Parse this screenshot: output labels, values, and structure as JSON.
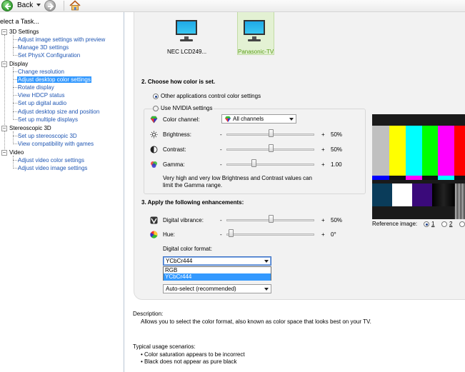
{
  "toolbar": {
    "back_label": "Back"
  },
  "sidebar": {
    "header": "elect a Task...",
    "categories": [
      {
        "label": "3D Settings",
        "items": [
          "Adjust image settings with preview",
          "Manage 3D settings",
          "Set PhysX Configuration"
        ]
      },
      {
        "label": "Display",
        "items": [
          "Change resolution",
          "Adjust desktop color settings",
          "Rotate display",
          "View HDCP status",
          "Set up digital audio",
          "Adjust desktop size and position",
          "Set up multiple displays"
        ]
      },
      {
        "label": "Stereoscopic 3D",
        "items": [
          "Set up stereoscopic 3D",
          "View compatibility with games"
        ]
      },
      {
        "label": "Video",
        "items": [
          "Adjust video color settings",
          "Adjust video image settings"
        ]
      }
    ],
    "selected_item": "Adjust desktop color settings"
  },
  "displays": [
    {
      "label": "NEC LCD249..."
    },
    {
      "label": "Panasonic-TV"
    }
  ],
  "section2": {
    "title": "2. Choose how color is set.",
    "radio_other": "Other applications control color settings",
    "radio_nvidia": "Use NVIDIA settings",
    "color_channel_label": "Color channel:",
    "color_channel_value": "All channels",
    "brightness": {
      "label": "Brightness:",
      "value": "50%",
      "level": 0.5
    },
    "contrast": {
      "label": "Contrast:",
      "value": "50%",
      "level": 0.5
    },
    "gamma": {
      "label": "Gamma:",
      "value": "1.00",
      "level": 0.3
    },
    "note": "Very high and very low Brightness and Contrast values can limit the Gamma range."
  },
  "section3": {
    "title": "3. Apply the following enhancements:",
    "vibrance": {
      "label": "Digital vibrance:",
      "value": "50%",
      "level": 0.5
    },
    "hue": {
      "label": "Hue:",
      "value": "0°",
      "level": 0.0
    },
    "format_label": "Digital color format:",
    "format_value": "YCbCr444",
    "format_options": [
      "RGB",
      "YCbCr444"
    ],
    "range_value": "Auto-select (recommended)"
  },
  "reference": {
    "label": "Reference image:",
    "options": [
      "1",
      "2"
    ],
    "selected": "1"
  },
  "description": {
    "title": "Description:",
    "text": "Allows you to select the color format, also known as color space that looks best on your TV."
  },
  "usage": {
    "title": "Typical usage scenarios:",
    "items": [
      "• Color saturation appears to be incorrect",
      "• Black does not appear as pure black"
    ]
  },
  "slider_signs": {
    "minus": "-",
    "plus": "+"
  },
  "colors": {
    "link": "#1f56b3",
    "selection": "#3399ff",
    "selected_display": "#5b9e1a",
    "pattern_bars": [
      "#c0c0c0",
      "#ffff00",
      "#00ffff",
      "#00ff00",
      "#ff00ff",
      "#ff0000",
      "#0000ff"
    ]
  },
  "icons": [
    "back-arrow-icon",
    "forward-arrow-icon",
    "home-icon",
    "monitor-icon",
    "color-channel-icon",
    "brightness-icon",
    "contrast-icon",
    "gamma-icon",
    "vibrance-icon",
    "hue-icon"
  ]
}
